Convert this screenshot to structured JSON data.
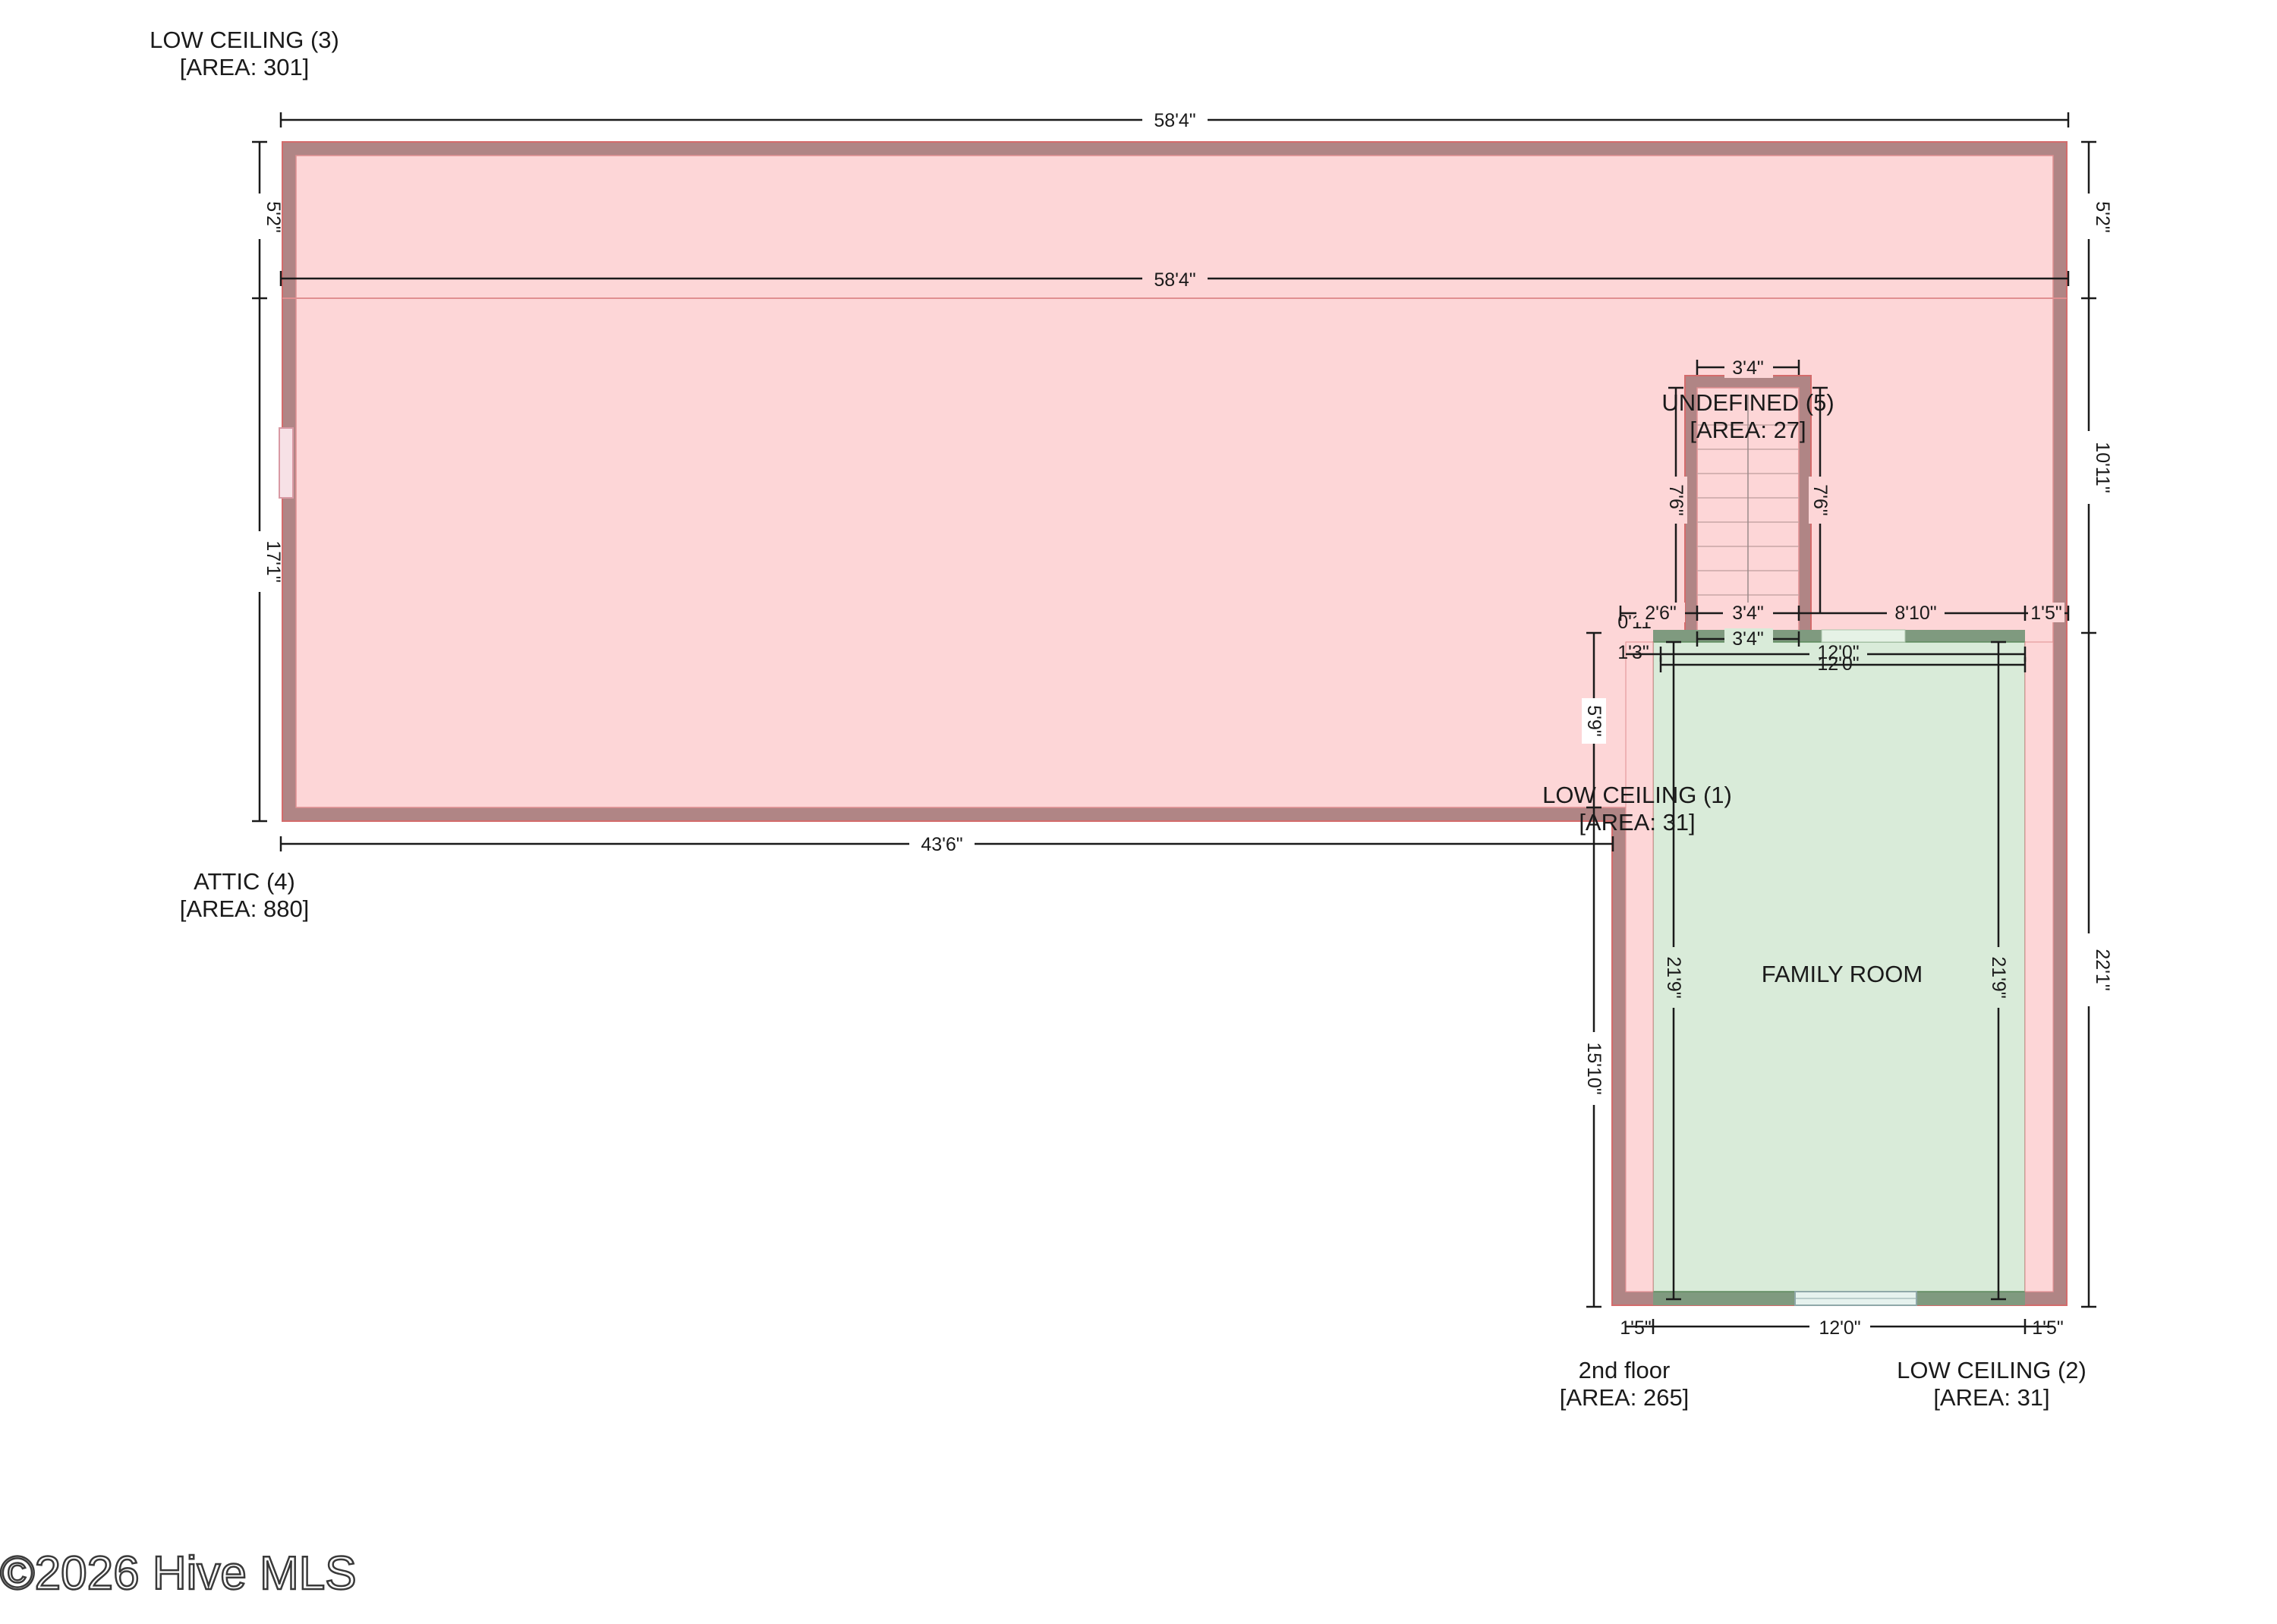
{
  "labels": {
    "low_ceiling_3": {
      "name": "LOW CEILING (3)",
      "area": "[AREA: 301]"
    },
    "attic_4": {
      "name": "ATTIC (4)",
      "area": "[AREA: 880]"
    },
    "undefined_5": {
      "name": "UNDEFINED (5)",
      "area": "[AREA: 27]"
    },
    "low_ceiling_1": {
      "name": "LOW CEILING (1)",
      "area": "[AREA: 31]"
    },
    "family_room": {
      "name": "FAMILY ROOM"
    },
    "floor_2nd": {
      "name": "2nd floor",
      "area": "[AREA: 265]"
    },
    "low_ceiling_2": {
      "name": "LOW CEILING (2)",
      "area": "[AREA: 31]"
    }
  },
  "dimensions": {
    "top_total": "58'4\"",
    "inner_total": "58'4\"",
    "bottom_attic": "43'6\"",
    "left_top": "5'2\"",
    "left_main": "17'1\"",
    "right_top": "5'2\"",
    "right_mid": "10'11\"",
    "right_low": "22'1\"",
    "stair_top": "3'4\"",
    "stair_left": "7'6\"",
    "stair_right": "7'6\"",
    "seg_0_11": "0'11\"",
    "seg_2_6": "2'6\"",
    "seg_3_4a": "3'4\"",
    "seg_8_10": "8'10\"",
    "seg_1_5_top": "1'5\"",
    "seg_3_4b": "3'4\"",
    "seg_1_3": "1'3\"",
    "fr_top_a": "12'0\"",
    "fr_top_b": "12'0\"",
    "fr_left_5_9": "5'9\"",
    "fr_left_15_10": "15'10\"",
    "fr_left_h": "21'9\"",
    "fr_right_h": "21'9\"",
    "bottom_left": "1'5\"",
    "bottom_mid": "12'0\"",
    "bottom_right": "1'5\""
  },
  "watermark": "©2026 Hive MLS",
  "colors": {
    "unconditioned_fill": "#fdd6d7",
    "wall": "#b08585",
    "living_fill": "#d9ebd9",
    "living_wall": "#7f9a7f",
    "outline": "#d46b6b"
  }
}
